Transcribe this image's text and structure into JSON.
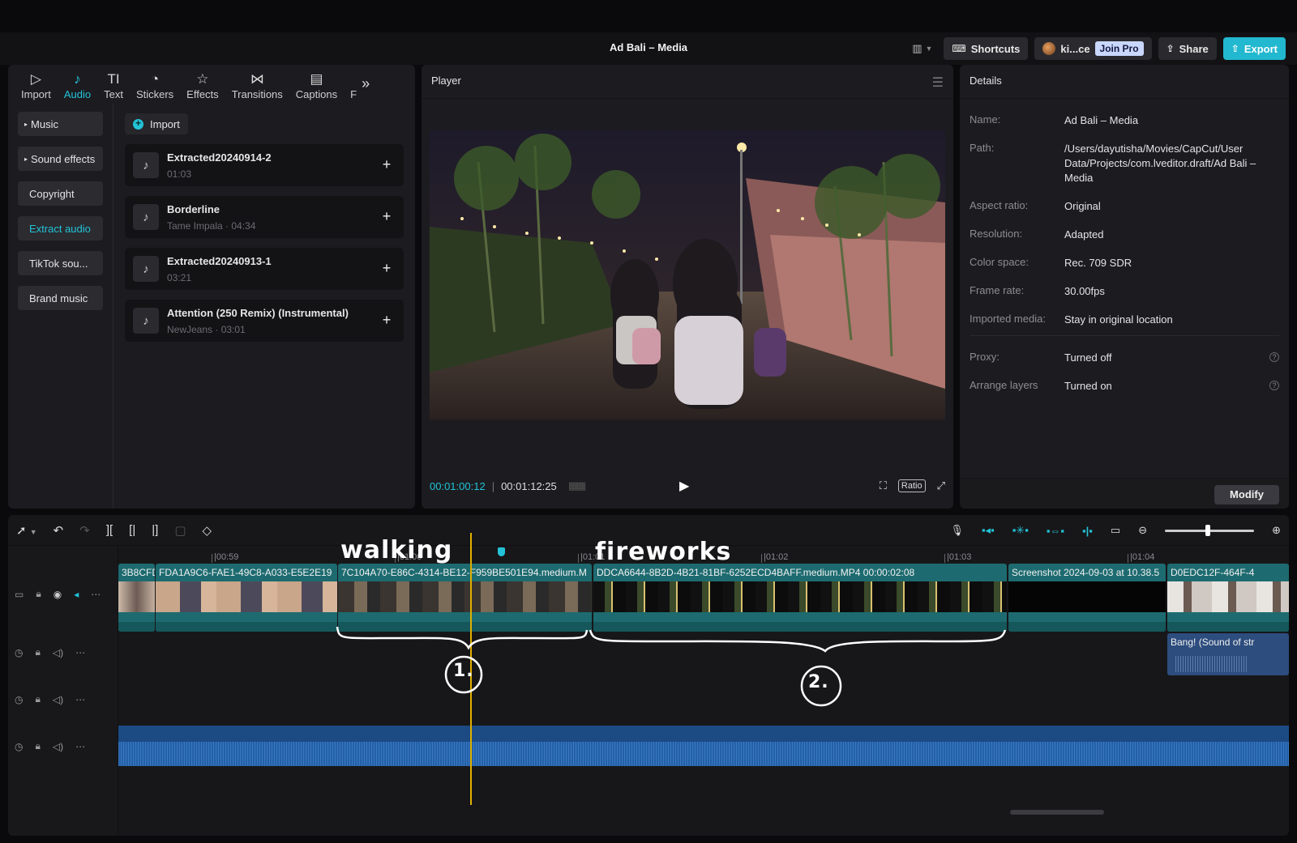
{
  "app": {
    "title": "Ad Bali – Media"
  },
  "topbar": {
    "shortcuts_label": "Shortcuts",
    "user_name": "ki...ce",
    "join_pro_label": "Join Pro",
    "share_label": "Share",
    "export_label": "Export"
  },
  "left_panel": {
    "tabs": [
      {
        "label": "Import",
        "icon": "import-icon"
      },
      {
        "label": "Audio",
        "icon": "audio-icon",
        "active": true
      },
      {
        "label": "Text",
        "icon": "text-icon"
      },
      {
        "label": "Stickers",
        "icon": "stickers-icon"
      },
      {
        "label": "Effects",
        "icon": "effects-icon"
      },
      {
        "label": "Transitions",
        "icon": "transitions-icon"
      },
      {
        "label": "Captions",
        "icon": "captions-icon"
      },
      {
        "label": "F",
        "icon": "filters-icon"
      }
    ],
    "subnav": [
      {
        "label": "Music",
        "caret": "▸"
      },
      {
        "label": "Sound effects",
        "caret": "▸"
      },
      {
        "label": "Copyright"
      },
      {
        "label": "Extract audio",
        "active": true
      },
      {
        "label": "TikTok sou..."
      },
      {
        "label": "Brand music"
      }
    ],
    "import_label": "Import",
    "tracks": [
      {
        "title": "Extracted20240914-2",
        "sub": "01:03"
      },
      {
        "title": "Borderline",
        "sub": "Tame Impala · 04:34"
      },
      {
        "title": "Extracted20240913-1",
        "sub": "03:21"
      },
      {
        "title": "Attention (250 Remix) (Instrumental)",
        "sub": "NewJeans · 03:01"
      }
    ]
  },
  "player": {
    "title": "Player",
    "current_time": "00:01:00:12",
    "total_time": "00:01:12:25",
    "ratio_label": "Ratio"
  },
  "details": {
    "title": "Details",
    "rows": [
      {
        "k": "Name:",
        "v": "Ad Bali – Media"
      },
      {
        "k": "Path:",
        "v": "/Users/dayutisha/Movies/CapCut/User Data/Projects/com.lveditor.draft/Ad Bali – Media"
      },
      {
        "k": "Aspect ratio:",
        "v": "Original"
      },
      {
        "k": "Resolution:",
        "v": "Adapted"
      },
      {
        "k": "Color space:",
        "v": "Rec. 709 SDR"
      },
      {
        "k": "Frame rate:",
        "v": "30.00fps"
      },
      {
        "k": "Imported media:",
        "v": "Stay in original location"
      }
    ],
    "rows2": [
      {
        "k": "Proxy:",
        "v": "Turned off"
      },
      {
        "k": "Arrange layers",
        "v": "Turned on"
      }
    ],
    "modify_label": "Modify"
  },
  "timeline": {
    "ruler": [
      "|00:59",
      "|01:00",
      "|01:01",
      "|01:02",
      "|01:03",
      "|01:04"
    ],
    "clips": [
      {
        "label": "3B8CFD"
      },
      {
        "label": "FDA1A9C6-FAE1-49C8-A033-E5E2E19"
      },
      {
        "label": "7C104A70-E86C-4314-BE12-F959BE501E94.medium.M"
      },
      {
        "label": "DDCA6644-8B2D-4B21-81BF-6252ECD4BAFF.medium.MP4   00:00:02:08"
      },
      {
        "label": "Screenshot 2024-09-03 at 10.38.5"
      },
      {
        "label": "D0EDC12F-464F-4"
      }
    ],
    "audio_clip_label": "Bang! (Sound of str"
  },
  "annotations": {
    "walking": "walking",
    "fireworks": "fireworks",
    "one": "1.",
    "two": "2."
  }
}
